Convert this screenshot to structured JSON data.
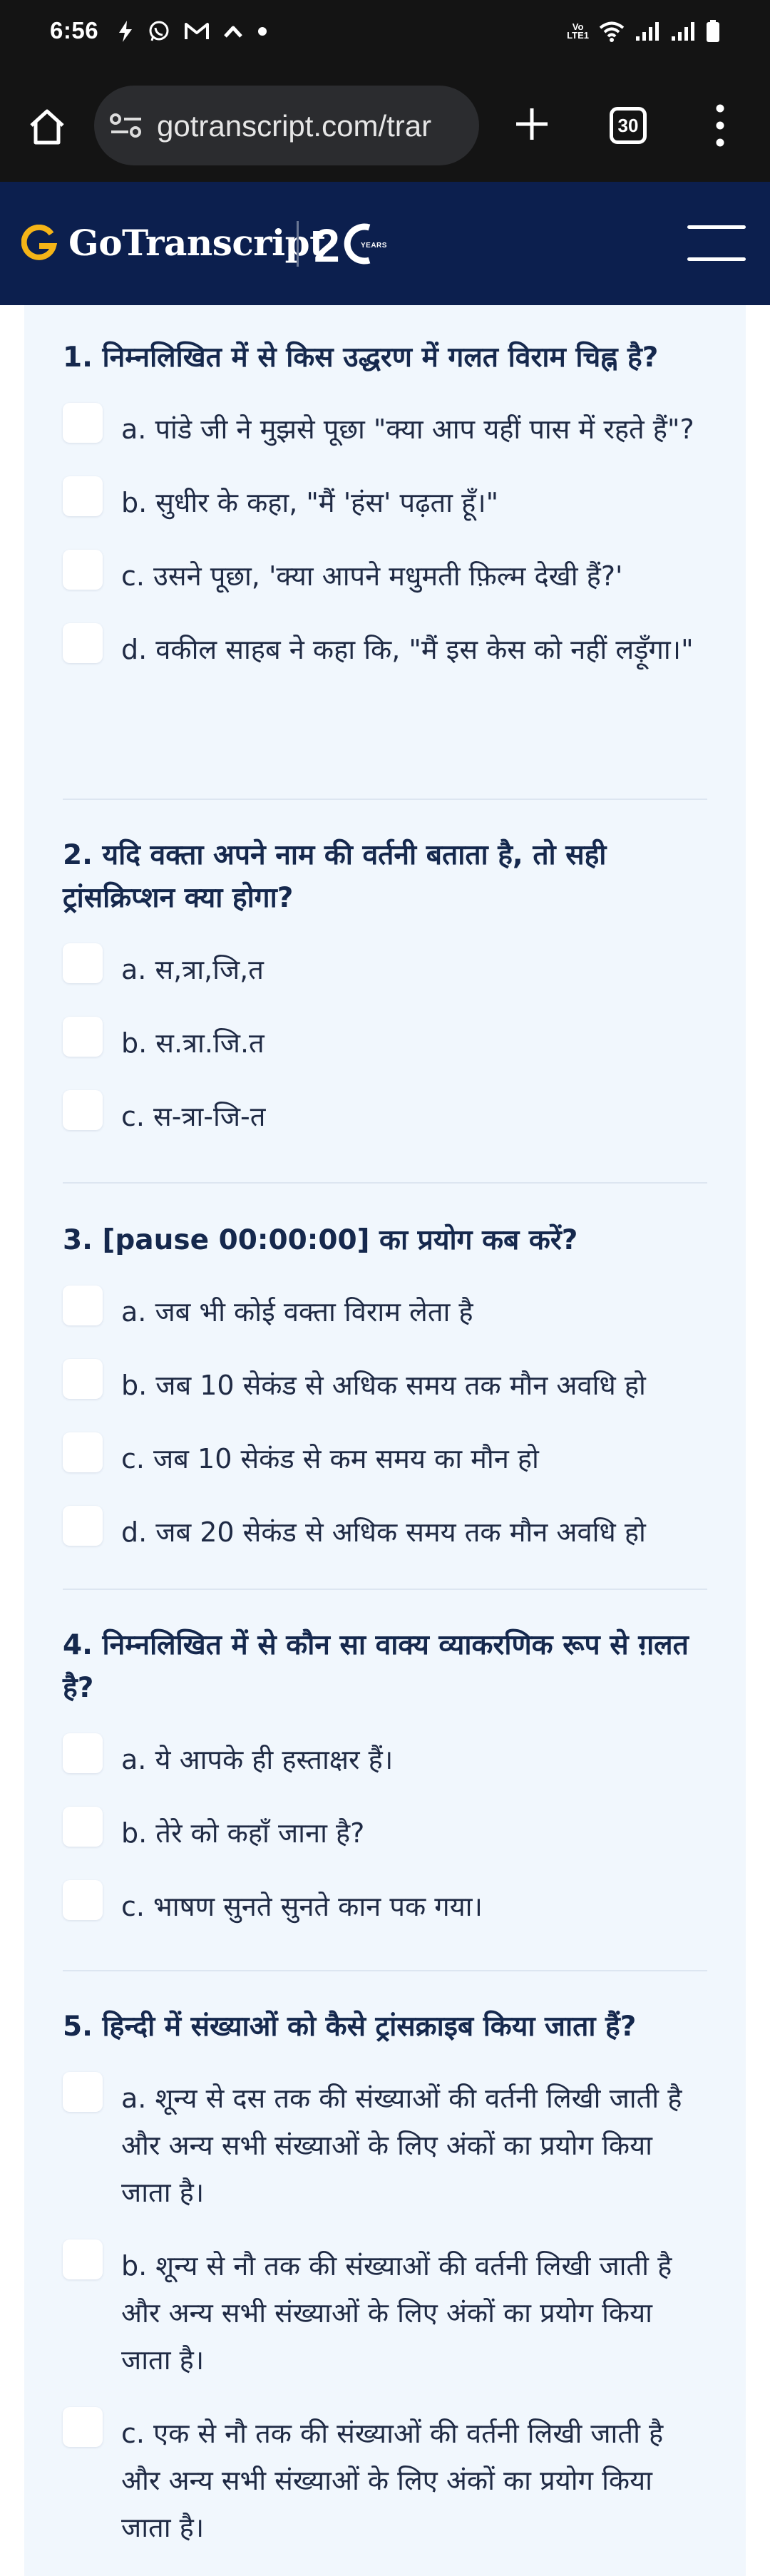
{
  "status_bar": {
    "time": "6:56",
    "notification_icons": [
      "bolt-icon",
      "whatsapp-icon",
      "gmail-icon",
      "caret-up-icon",
      "dot-icon"
    ],
    "network_label": "Vo\nLTE1",
    "right_icons": [
      "wifi-icon",
      "signal-icon",
      "signal-icon",
      "battery-icon"
    ]
  },
  "browser": {
    "url": "gotranscript.com/translation-and-transcription/...",
    "url_visible": "gotranscript.com/trar",
    "tab_count": "30",
    "icons": [
      "home-icon",
      "site-settings-icon",
      "plus-icon",
      "tabs-icon",
      "more-vert-icon"
    ]
  },
  "site_header": {
    "brand": "GoTranscript",
    "anniversary_digits": "20",
    "anniversary_word": "YEARS",
    "colors": {
      "background": "#0c1f4e",
      "accent": "#f5b417"
    }
  },
  "questions": [
    {
      "title": "1. निम्नलिखित में से किस उद्धरण में गलत विराम चिह्न है?",
      "options": [
        "a. पांडे जी ने मुझसे पूछा \"क्या आप यहीं पास में रहते हैं\"?",
        "b. सुधीर के कहा, \"मैं 'हंस' पढ़ता हूँ।\"",
        "c. उसने पूछा, 'क्या आपने मधुमती फ़िल्म देखी हैं?'",
        "d. वकील साहब ने कहा कि, \"मैं इस केस को नहीं लड़ूँगा।\""
      ]
    },
    {
      "title": "2. यदि वक्ता अपने नाम की वर्तनी बताता है, तो सही ट्रांसक्रिप्शन क्या होगा?",
      "options": [
        "a. स,त्रा,जि,त",
        "b. स.त्रा.जि.त",
        "c. स-त्रा-जि-त"
      ]
    },
    {
      "title": "3. [pause 00:00:00] का प्रयोग कब करें?",
      "options": [
        "a. जब भी कोई वक्ता विराम लेता है",
        "b. जब 10 सेकंड से अधिक समय तक मौन अवधि हो",
        "c. जब 10 सेकंड से कम समय का मौन हो",
        "d. जब 20 सेकंड से अधिक समय तक मौन अवधि हो"
      ]
    },
    {
      "title": "4. निम्नलिखित में से कौन सा वाक्य व्याकरणिक रूप से ग़लत है?",
      "options": [
        "a. ये आपके ही हस्ताक्षर हैं।",
        "b. तेरे को कहाँ जाना है?",
        "c. भाषण सुनते सुनते कान पक गया।"
      ]
    },
    {
      "title": "5. हिन्दी में संख्याओं को कैसे ट्रांसक्राइब किया जाता हैं?",
      "options": [
        "a. शून्य से दस तक की संख्याओं की वर्तनी लिखी जाती है और अन्य सभी संख्याओं के लिए अंकों का प्रयोग किया जाता है।",
        "b. शून्य से नौ तक की संख्याओं की वर्तनी लिखी जाती है और अन्य सभी संख्याओं के लिए अंकों का प्रयोग किया जाता है।",
        "c. एक से नौ तक की संख्याओं की वर्तनी लिखी जाती है और अन्य सभी संख्याओं के लिए अंकों का प्रयोग किया जाता है।"
      ]
    }
  ]
}
